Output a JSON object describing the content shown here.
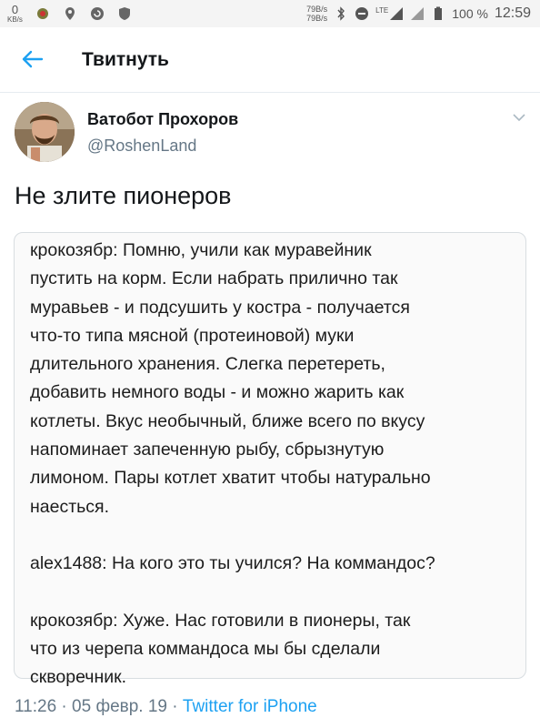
{
  "status_bar": {
    "net_speed": "0",
    "net_speed_unit": "KB/s",
    "speed_up": "79B/s",
    "speed_down": "79B/s",
    "lte": "LTE",
    "battery": "100 %",
    "time": "12:59"
  },
  "toolbar": {
    "title": "Твитнуть"
  },
  "tweet": {
    "author_name": "Ватобот Прохоров",
    "author_handle": "@RoshenLand",
    "text": "Не злите пионеров",
    "quote": [
      "крокозябр: Помню, учили как муравейник",
      "пустить на корм. Если набрать прилично так",
      "муравьев - и подсушить у костра - получается",
      "что-то типа мясной (протеиновой) муки",
      "длительного хранения. Слегка перетереть,",
      "добавить немного воды - и можно жарить как",
      "котлеты. Вкус необычный, ближе всего по вкусу",
      "напоминает запеченную рыбу, сбрызнутую",
      "лимоном. Пары котлет хватит чтобы натурально",
      "наесться.",
      "",
      "alex1488: На кого это ты учился? На коммандос?",
      "",
      "крокозябр: Хуже. Нас готовили в пионеры, так",
      "что из черепа коммандоса мы бы сделали",
      "скворечник."
    ],
    "time": "11:26",
    "separator": "·",
    "date": "05 февр. 19",
    "source": "Twitter for iPhone"
  }
}
